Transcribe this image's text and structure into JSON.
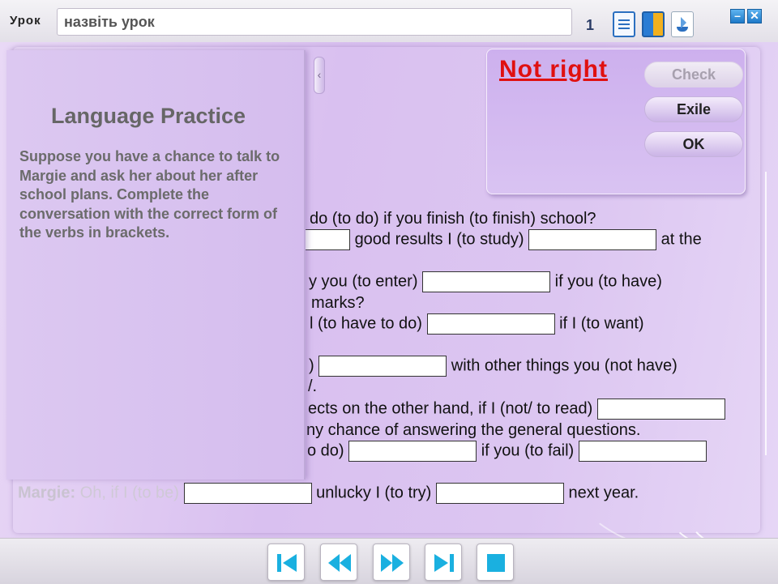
{
  "topbar": {
    "lesson_label": "Урок",
    "lesson_title_value": "назвіть урок",
    "page_number": "1",
    "icons": [
      "document-icon",
      "book-icon",
      "ship-icon"
    ]
  },
  "window_controls": {
    "minimize": "–",
    "close": "✕"
  },
  "info_panel": {
    "title": "Language Practice",
    "text": "Suppose you have a chance to talk to Margie and ask her about her after school plans. Complete the conversation with the correct form of the verbs in brackets.",
    "collapse_glyph": "‹"
  },
  "check_panel": {
    "result": "Not right",
    "result_color": "#e01010",
    "check_label": "Check",
    "exile_label": "Exile",
    "ok_label": "OK"
  },
  "exercise": {
    "l1": "do (to do) if you finish (to finish) school?",
    "l2_mid": "good results I (to study)",
    "l2_end": "at the",
    "l3_start": "y you (to enter)",
    "l3_end": "if you (to have)",
    "l4": "marks?",
    "l5_start": "l (to have to do)",
    "l5_end": "if I (to want)",
    "l6_start": ")",
    "l6_end": "with other things you (not have)",
    "l7": "/.",
    "l8_start": "ects on the other hand, if I (not/ to read)",
    "l9": "ny chance of answering the general questions.",
    "l10_start": "o do)",
    "l10_mid": "if you (to fail)",
    "margie_label": "Margie:",
    "l11_start": "Oh, if I (to be)",
    "l11_mid": "unlucky I (to try)",
    "l11_end": "next year."
  },
  "nav": [
    "first-icon",
    "previous-icon",
    "next-icon",
    "last-icon",
    "stop-icon"
  ],
  "colors": {
    "accent": "#1ab0e0",
    "panel": "#d5bdee"
  }
}
